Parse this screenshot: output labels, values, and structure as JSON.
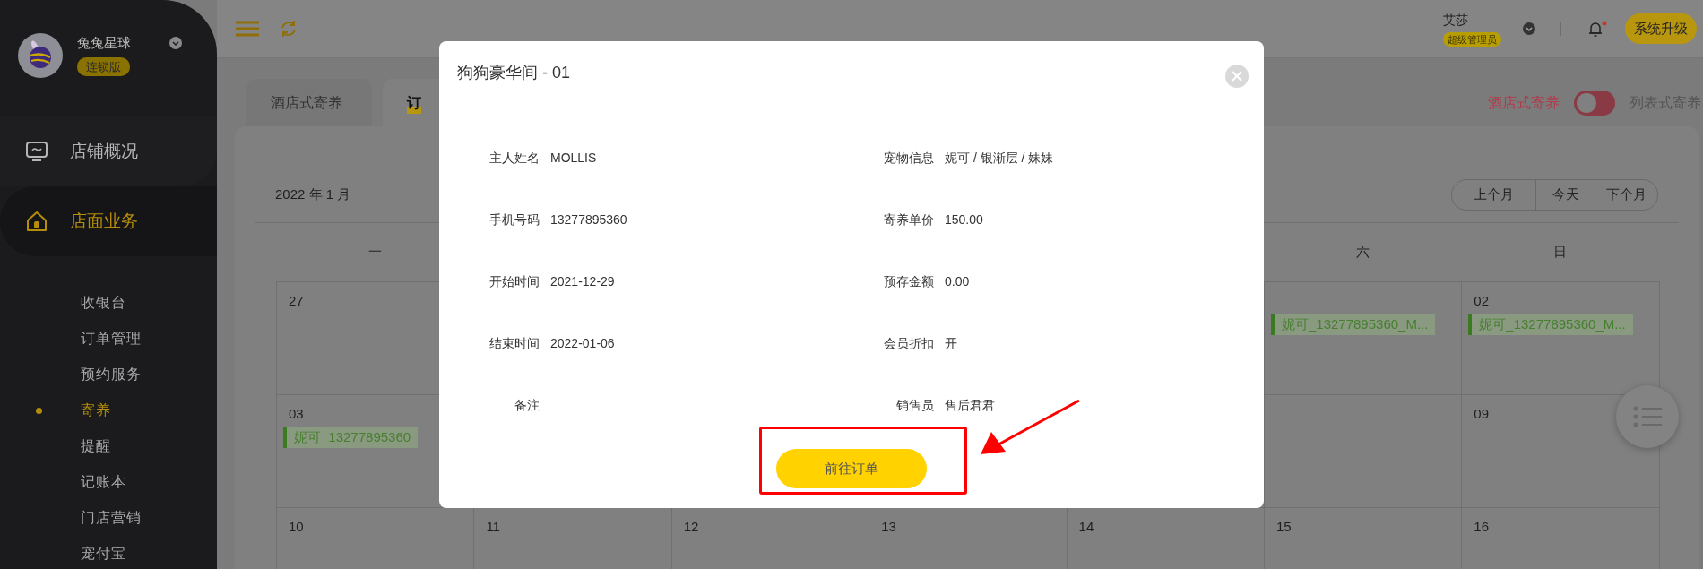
{
  "sidebar": {
    "store_name": "兔兔星球",
    "edition": "连锁版",
    "nav": [
      {
        "label": "店铺概况",
        "selected": false
      },
      {
        "label": "店面业务",
        "selected": true,
        "children": [
          {
            "label": "收银台",
            "selected": false
          },
          {
            "label": "订单管理",
            "selected": false
          },
          {
            "label": "预约服务",
            "selected": false
          },
          {
            "label": "寄养",
            "selected": true
          },
          {
            "label": "提醒",
            "selected": false
          },
          {
            "label": "记账本",
            "selected": false
          },
          {
            "label": "门店营销",
            "selected": false
          },
          {
            "label": "宠付宝",
            "selected": false
          }
        ]
      }
    ]
  },
  "header": {
    "user_name": "艾莎",
    "role": "超级管理员",
    "unread_notifications": true,
    "upgrade_button": "系统升级"
  },
  "tabs": [
    {
      "label": "酒店式寄养",
      "selected": false
    },
    {
      "label": "订",
      "selected": true
    }
  ],
  "view_switch": {
    "left_label": "酒店式寄养",
    "right_label": "列表式寄养",
    "on": false
  },
  "calendar": {
    "title": "2022 年 1 月",
    "nav_buttons": [
      "上个月",
      "今天",
      "下个月"
    ],
    "weekdays": {
      "monday": "一",
      "saturday": "六",
      "sunday": "日"
    },
    "weeks": [
      {
        "monday": {
          "date": "27"
        },
        "saturday": {
          "events": [
            "妮可_13277895360_M..."
          ]
        },
        "sunday": {
          "date": "02",
          "events": [
            "妮可_13277895360_M..."
          ]
        }
      },
      {
        "monday": {
          "date": "03",
          "events": [
            "妮可_13277895360"
          ]
        },
        "sunday": {
          "date": "09"
        }
      },
      {
        "monday": {
          "date": "10"
        },
        "tuesday": {
          "date": "11"
        },
        "wednesday": {
          "date": "12"
        },
        "thursday": {
          "date": "13"
        },
        "friday": {
          "date": "14"
        },
        "saturday": {
          "date": "15"
        },
        "sunday": {
          "date": "16"
        }
      }
    ]
  },
  "modal": {
    "title": "狗狗豪华间 - 01",
    "fields": [
      {
        "label": "主人姓名",
        "value": "MOLLIS"
      },
      {
        "label": "宠物信息",
        "value": "妮可 / 银渐层 / 妹妹"
      },
      {
        "label": "手机号码",
        "value": "13277895360"
      },
      {
        "label": "寄养单价",
        "value": "150.00"
      },
      {
        "label": "开始时间",
        "value": "2021-12-29"
      },
      {
        "label": "预存金额",
        "value": "0.00"
      },
      {
        "label": "结束时间",
        "value": "2022-01-06"
      },
      {
        "label": "会员折扣",
        "value": "开"
      },
      {
        "label": "备注"
      },
      {
        "label": "销售员",
        "value": "售后君君"
      }
    ],
    "button": "前往订单"
  }
}
